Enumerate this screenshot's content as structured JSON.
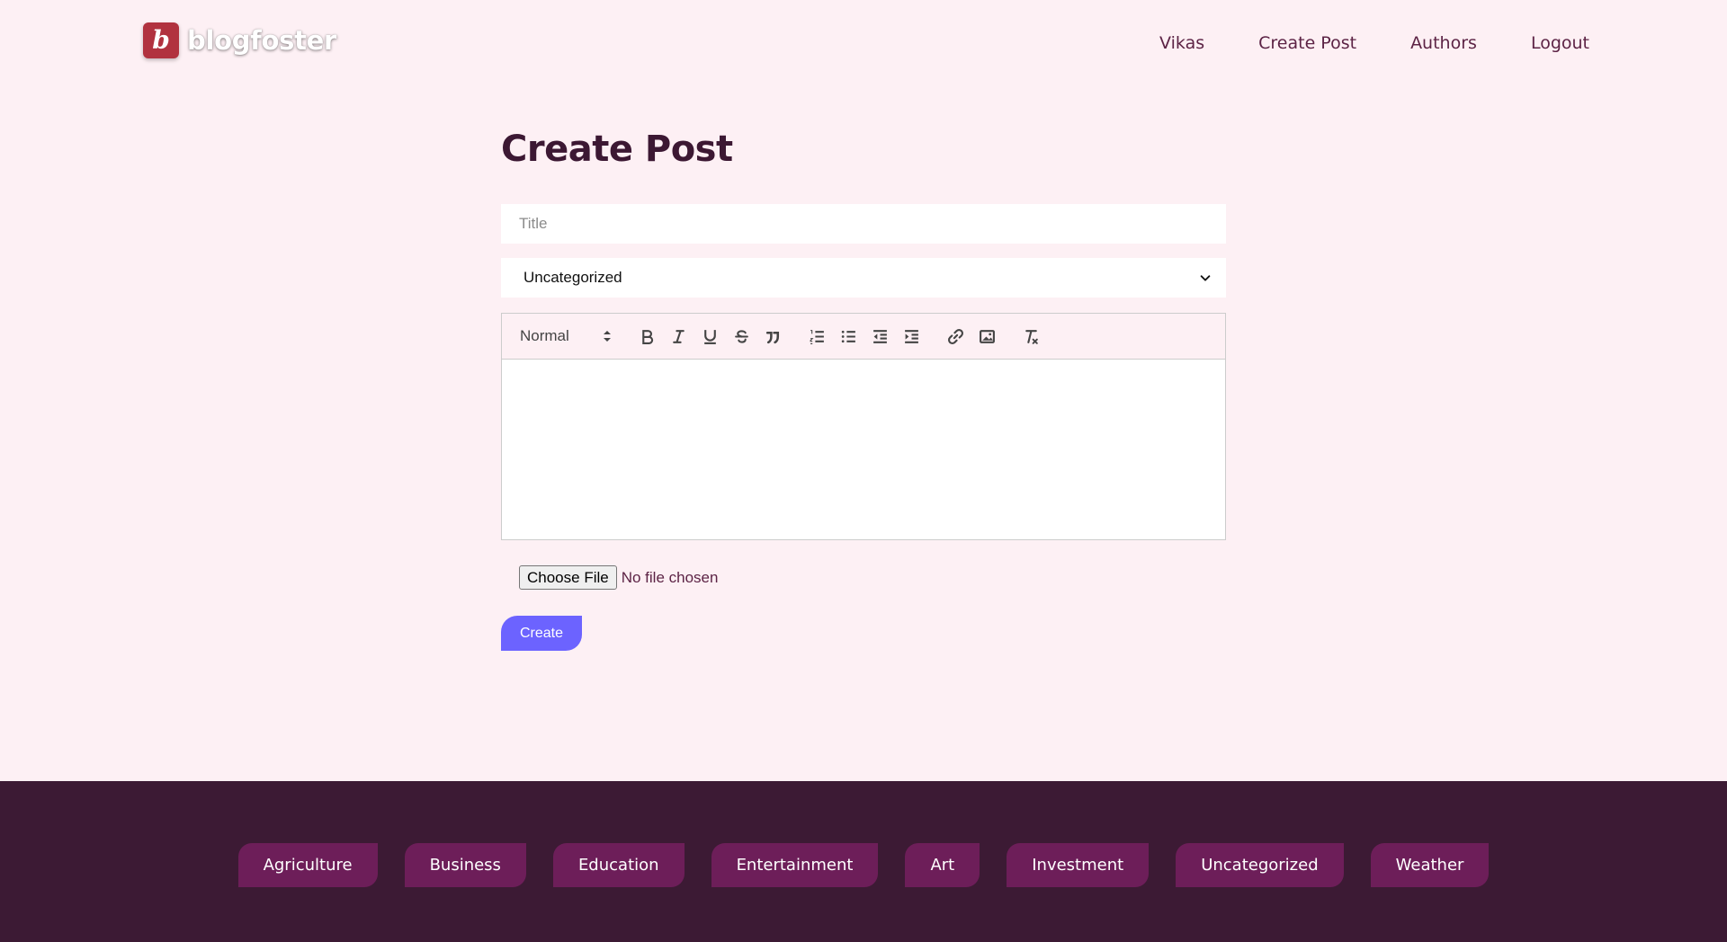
{
  "header": {
    "logo_text": "blogfoster",
    "logo_mark": "b",
    "nav": [
      "Vikas",
      "Create Post",
      "Authors",
      "Logout"
    ]
  },
  "main": {
    "page_title": "Create Post",
    "title_placeholder": "Title",
    "title_value": "",
    "category_selected": "Uncategorized",
    "editor": {
      "header_select": "Normal",
      "toolbar_icons": [
        "bold-icon",
        "italic-icon",
        "underline-icon",
        "strike-icon",
        "blockquote-icon",
        "ordered-list-icon",
        "bullet-list-icon",
        "outdent-icon",
        "indent-icon",
        "link-icon",
        "image-icon",
        "clear-format-icon"
      ],
      "content": ""
    },
    "file_button_label": "Choose File",
    "file_status": "No file chosen",
    "create_button_label": "Create"
  },
  "footer": {
    "categories": [
      "Agriculture",
      "Business",
      "Education",
      "Entertainment",
      "Art",
      "Investment",
      "Uncategorized",
      "Weather"
    ]
  },
  "colors": {
    "page_bg": "#fdf0f4",
    "nav_text": "#5c2345",
    "title_text": "#3c1833",
    "accent": "#6c63ff",
    "footer_bg": "#3c1a34",
    "category_bg": "#6d1e59",
    "logo_bg": "#b1323f"
  }
}
